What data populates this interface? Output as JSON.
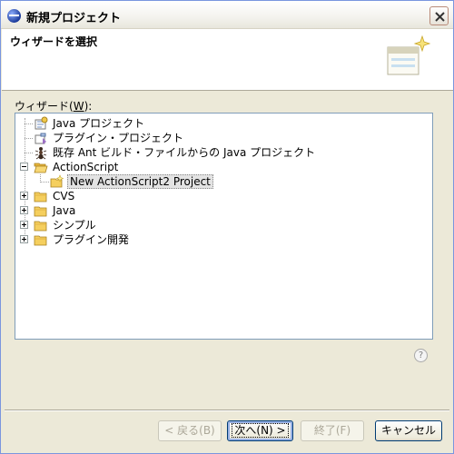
{
  "window": {
    "title": "新規プロジェクト"
  },
  "header": {
    "title": "ウィザードを選択"
  },
  "wizard": {
    "label_prefix": "ウィザード(",
    "label_mnemonic": "W",
    "label_suffix": "):",
    "items": [
      {
        "label": "Java プロジェクト",
        "icon": "java-project-icon"
      },
      {
        "label": "プラグイン・プロジェクト",
        "icon": "plugin-project-icon"
      },
      {
        "label": "既存 Ant ビルド・ファイルからの Java プロジェクト",
        "icon": "ant-icon"
      },
      {
        "label": "ActionScript",
        "icon": "folder-open-icon",
        "expanded": true
      },
      {
        "label": "New ActionScript2 Project",
        "icon": "wizard-icon",
        "selected": true
      },
      {
        "label": "CVS",
        "icon": "folder-icon",
        "expanded": false
      },
      {
        "label": "Java",
        "icon": "folder-icon",
        "expanded": false
      },
      {
        "label": "シンプル",
        "icon": "folder-icon",
        "expanded": false
      },
      {
        "label": "プラグイン開発",
        "icon": "folder-icon",
        "expanded": false
      }
    ]
  },
  "help": {
    "glyph": "?"
  },
  "buttons": {
    "back": "< 戻る(B)",
    "next": "次へ(N) >",
    "finish": "終了(F)",
    "cancel": "キャンセル"
  },
  "colors": {
    "window_bg": "#ece9d8",
    "tree_border": "#7f9db9",
    "folder": "#f5c342"
  }
}
